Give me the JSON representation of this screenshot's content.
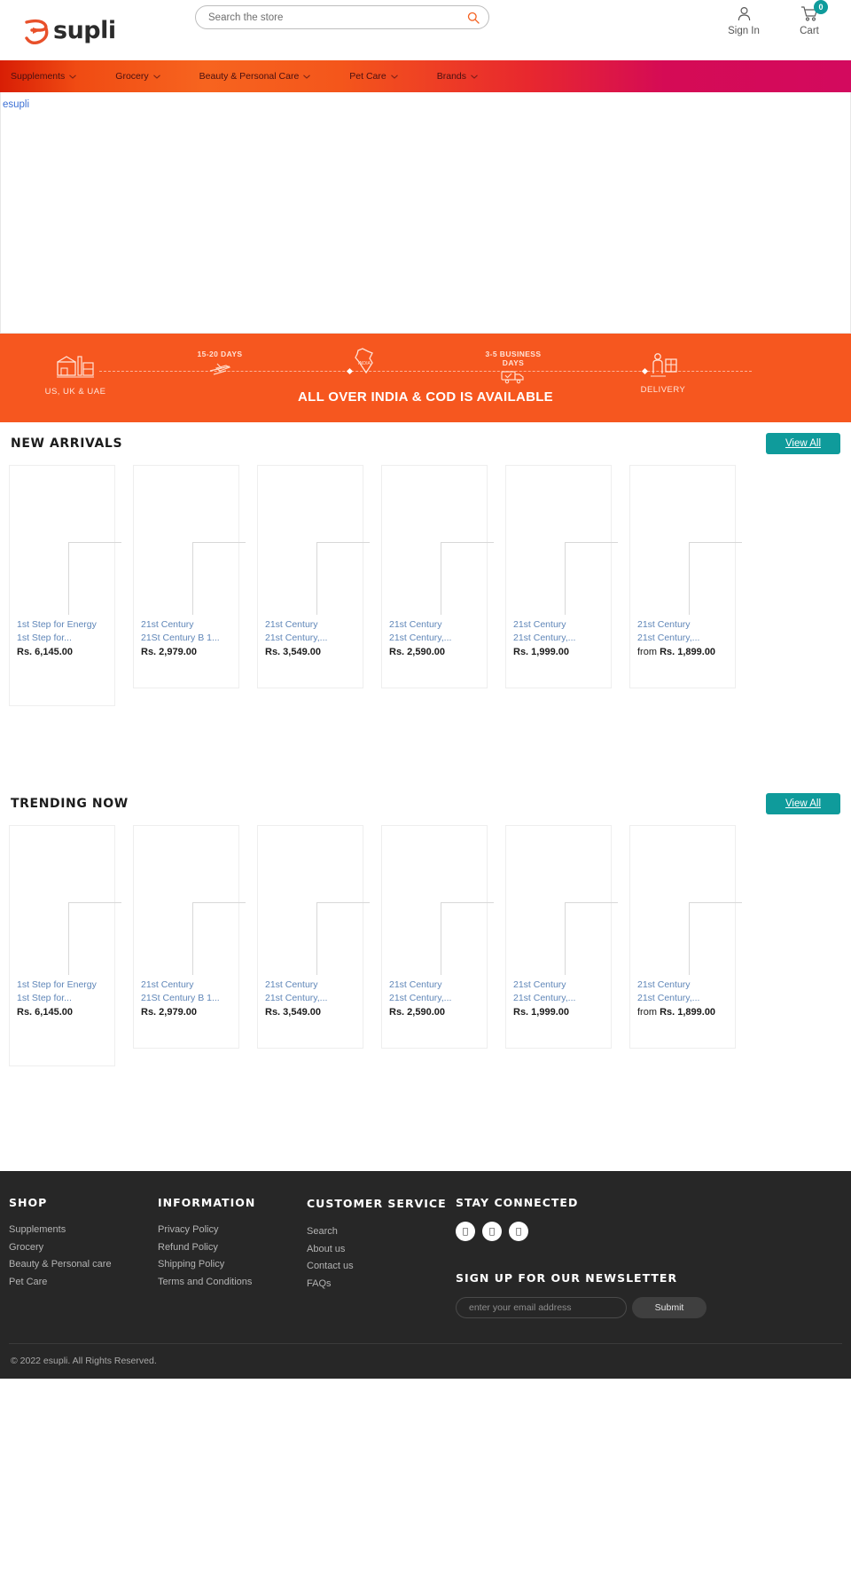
{
  "brand": {
    "name": "supli",
    "logo_icon": "esupli-swirl-logo",
    "alt_text": "esupli",
    "accent_orange": "#F6571F",
    "accent_teal": "#0F9B9B",
    "footer_bg": "#272727"
  },
  "search": {
    "placeholder": "Search the store",
    "value": "",
    "icon": "search-icon"
  },
  "header_actions": {
    "signin_label": "Sign In",
    "signin_icon": "user-icon",
    "cart_label": "Cart",
    "cart_icon": "cart-icon",
    "cart_count": "0"
  },
  "nav": {
    "items": [
      {
        "label": "Supplements",
        "caret": "chevron-down-icon"
      },
      {
        "label": "Grocery",
        "caret": "chevron-down-icon"
      },
      {
        "label": "Beauty & Personal Care",
        "caret": "chevron-down-icon"
      },
      {
        "label": "Pet Care",
        "caret": "chevron-down-icon"
      },
      {
        "label": "Brands",
        "caret": "chevron-down-icon"
      }
    ]
  },
  "hero": {
    "broken_image_alt": "esupli"
  },
  "ship_banner": {
    "origin_icon": "warehouse-truck-icon",
    "origin_label": "US, UK & UAE",
    "air_caption": "15-20 DAYS",
    "air_icon": "airplane-icon",
    "india_icon": "india-map-icon",
    "ground_caption": "3-5 BUSINESS DAYS",
    "ground_icon": "delivery-truck-icon",
    "delivery_icon": "courier-delivery-icon",
    "delivery_label": "DELIVERY",
    "center_text": "ALL OVER INDIA & COD IS AVAILABLE"
  },
  "sections": [
    {
      "title": "NEW ARRIVALS",
      "view_all_label": "View All",
      "products": [
        {
          "vendor": "1st Step for Energy",
          "name": "1st Step for...",
          "price": "Rs. 6,145.00",
          "price_prefix": "",
          "image": "broken-product-image"
        },
        {
          "vendor": "21st Century",
          "name": "21St Century B 1...",
          "price": "Rs. 2,979.00",
          "price_prefix": "",
          "image": "broken-product-image"
        },
        {
          "vendor": "21st Century",
          "name": "21st Century,...",
          "price": "Rs. 3,549.00",
          "price_prefix": "",
          "image": "broken-product-image"
        },
        {
          "vendor": "21st Century",
          "name": "21st Century,...",
          "price": "Rs. 2,590.00",
          "price_prefix": "",
          "image": "broken-product-image"
        },
        {
          "vendor": "21st Century",
          "name": "21st Century,...",
          "price": "Rs. 1,999.00",
          "price_prefix": "",
          "image": "broken-product-image"
        },
        {
          "vendor": "21st Century",
          "name": "21st Century,...",
          "price": "Rs. 1,899.00",
          "price_prefix": "from ",
          "image": "broken-product-image"
        }
      ]
    },
    {
      "title": "TRENDING NOW",
      "view_all_label": "View All",
      "products": [
        {
          "vendor": "1st Step for Energy",
          "name": "1st Step for...",
          "price": "Rs. 6,145.00",
          "price_prefix": "",
          "image": "broken-product-image"
        },
        {
          "vendor": "21st Century",
          "name": "21St Century B 1...",
          "price": "Rs. 2,979.00",
          "price_prefix": "",
          "image": "broken-product-image"
        },
        {
          "vendor": "21st Century",
          "name": "21st Century,...",
          "price": "Rs. 3,549.00",
          "price_prefix": "",
          "image": "broken-product-image"
        },
        {
          "vendor": "21st Century",
          "name": "21st Century,...",
          "price": "Rs. 2,590.00",
          "price_prefix": "",
          "image": "broken-product-image"
        },
        {
          "vendor": "21st Century",
          "name": "21st Century,...",
          "price": "Rs. 1,999.00",
          "price_prefix": "",
          "image": "broken-product-image"
        },
        {
          "vendor": "21st Century",
          "name": "21st Century,...",
          "price": "Rs. 1,899.00",
          "price_prefix": "from ",
          "image": "broken-product-image"
        }
      ]
    }
  ],
  "footer": {
    "shop": {
      "title": "SHOP",
      "links": [
        "Supplements",
        "Grocery",
        "Beauty & Personal care",
        "Pet Care"
      ]
    },
    "information": {
      "title": "INFORMATION",
      "links": [
        "Privacy Policy",
        "Refund Policy",
        "Shipping Policy",
        "Terms and Conditions"
      ]
    },
    "customer_service": {
      "title": "CUSTOMER SERVICE",
      "links": [
        "Search",
        "About us",
        "Contact us",
        "FAQs"
      ]
    },
    "social": {
      "title": "STAY CONNECTED",
      "icons": [
        "facebook-icon",
        "instagram-icon",
        "twitter-icon"
      ]
    },
    "newsletter": {
      "title": "SIGN UP FOR OUR NEWSLETTER",
      "placeholder": "enter your email address",
      "value": "",
      "submit_label": "Submit"
    },
    "copyright": "© 2022 esupli. All Rights Reserved."
  }
}
